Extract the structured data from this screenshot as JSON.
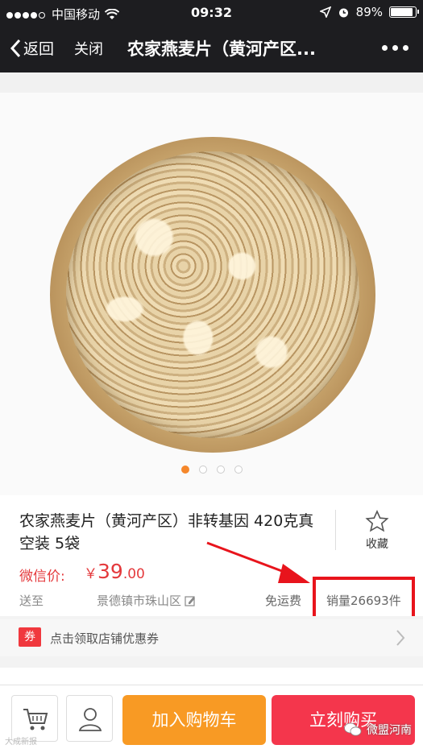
{
  "status_bar": {
    "carrier": "中国移动",
    "time": "09:32",
    "battery": "89%",
    "battery_level": 0.89
  },
  "nav": {
    "back_label": "返回",
    "close_label": "关闭",
    "title": "农家燕麦片（黄河产区..."
  },
  "gallery": {
    "image_count": 4,
    "active_index": 0
  },
  "product": {
    "name": "农家燕麦片（黄河产区）非转基因 420克真空装 5袋",
    "favorite_label": "收藏",
    "price_label": "微信价:",
    "currency": "￥",
    "price_int": "39",
    "price_dec": ".00",
    "ship_to_label": "送至",
    "location": "景德镇市珠山区",
    "shipping": "免运费",
    "sales": "销量26693件"
  },
  "coupon": {
    "tag": "券",
    "text": "点击领取店铺优惠券"
  },
  "actions": {
    "add_to_cart": "加入购物车",
    "buy_now": "立刻购买"
  },
  "watermarks": {
    "left": "大成新报",
    "right": "微盟河南"
  },
  "colors": {
    "price_red": "#e4393c",
    "add_cart_orange": "#f89a24",
    "buy_now_red": "#f4364c",
    "highlight_red": "#e8141c",
    "nav_bg": "#1d1d20"
  }
}
